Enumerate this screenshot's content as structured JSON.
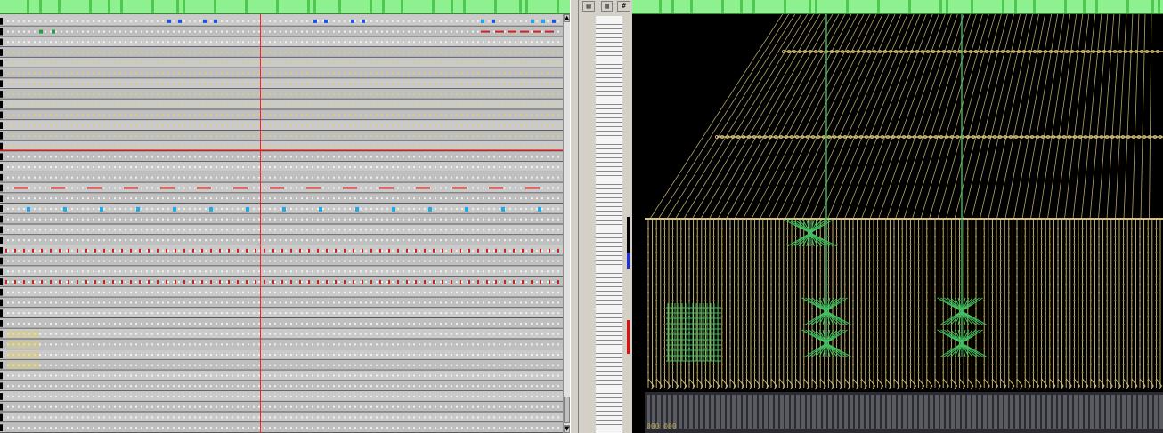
{
  "colors": {
    "strip_green": "#8ef08e",
    "strip_dark_green": "#4fc84f",
    "track_bg": "#c4c4c4",
    "track_line": "#5a5a5a",
    "note_yellow": "#d8cc80",
    "note_blue": "#2050e0",
    "note_cyan": "#20a8e8",
    "note_red": "#d02020",
    "note_green": "#20a040",
    "playhead": "#ff2020",
    "thread_yellow": "#d6c27a",
    "thread_green": "#40c060",
    "heddle_grey": "#5a5a62",
    "marker_black": "#000000",
    "marker_blue": "#2030e0",
    "marker_red": "#e01010"
  },
  "toolbar": {
    "icons": [
      "grid-view-icon",
      "list-view-icon",
      "hash-icon"
    ],
    "hash_label": "#"
  },
  "sequencer": {
    "track_count": 40,
    "playhead_beat": 9.3
  },
  "loom": {
    "bottom_label": "000 000"
  }
}
